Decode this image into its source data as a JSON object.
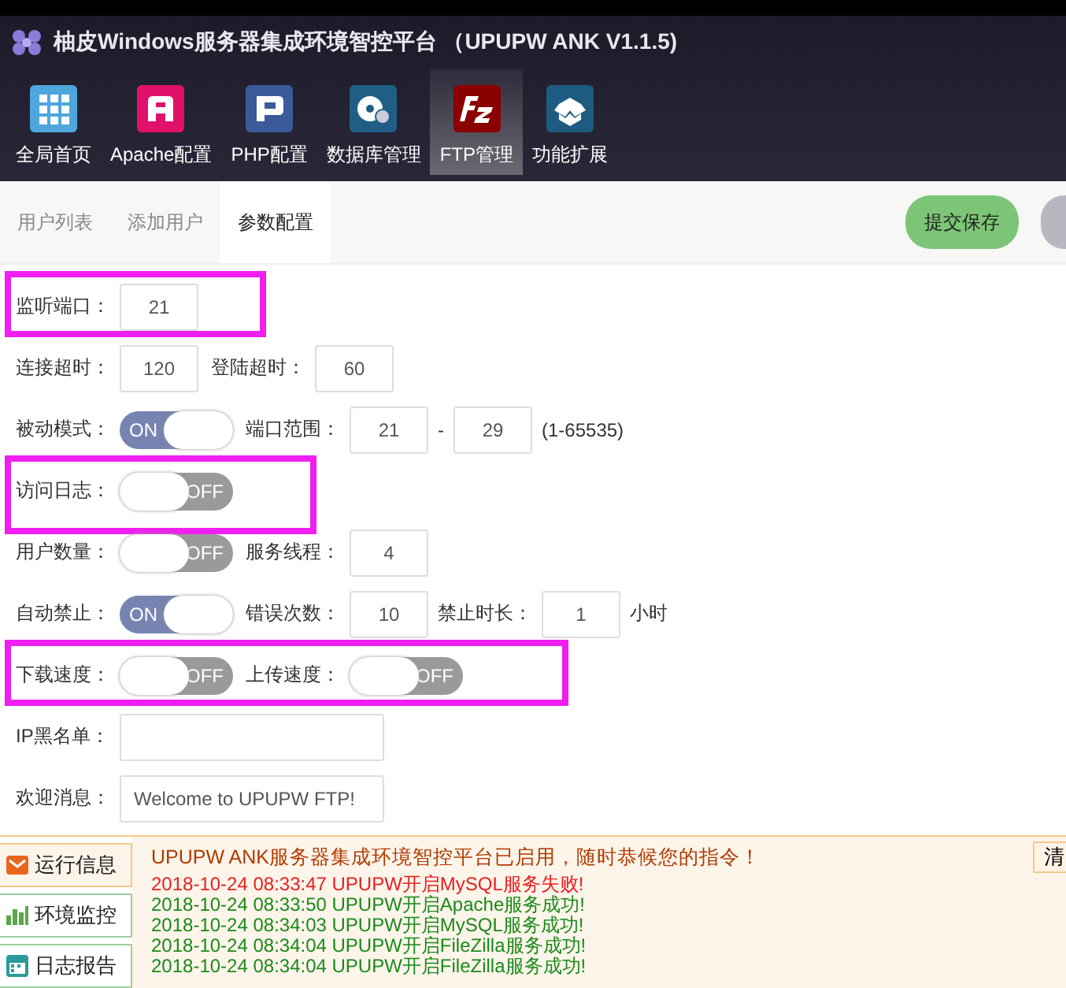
{
  "window": {
    "title": "柚皮Windows服务器集成环境智控平台 （UPUPW ANK V1.1.5)"
  },
  "toolbar": [
    {
      "label": "全局首页",
      "kind": "grid",
      "selected": false
    },
    {
      "label": "Apache配置",
      "kind": "apache",
      "selected": false
    },
    {
      "label": "PHP配置",
      "kind": "php",
      "selected": false
    },
    {
      "label": "数据库管理",
      "kind": "database",
      "selected": false
    },
    {
      "label": "FTP管理",
      "kind": "ftp",
      "selected": true
    },
    {
      "label": "功能扩展",
      "kind": "box",
      "selected": false
    }
  ],
  "sub_tabs": [
    {
      "label": "用户列表",
      "selected": false
    },
    {
      "label": "添加用户",
      "selected": false
    },
    {
      "label": "参数配置",
      "selected": true
    }
  ],
  "save_button": "提交保存",
  "form_rows": [
    {
      "highlighted": true,
      "items": [
        {
          "kind": "label",
          "text": "监听端口："
        },
        {
          "kind": "input",
          "value": "21"
        }
      ]
    },
    {
      "highlighted": false,
      "items": [
        {
          "kind": "label",
          "text": "连接超时："
        },
        {
          "kind": "input",
          "value": "120"
        },
        {
          "kind": "label",
          "text": "登陆超时："
        },
        {
          "kind": "input",
          "value": "60"
        }
      ]
    },
    {
      "highlighted": false,
      "items": [
        {
          "kind": "label",
          "text": "被动模式："
        },
        {
          "kind": "toggle",
          "on": true,
          "text": "ON"
        },
        {
          "kind": "label",
          "text": "端口范围："
        },
        {
          "kind": "input",
          "value": "21"
        },
        {
          "kind": "text",
          "text": "-"
        },
        {
          "kind": "input",
          "value": "29"
        },
        {
          "kind": "text",
          "text": "(1-65535)"
        }
      ]
    },
    {
      "highlighted": true,
      "items": [
        {
          "kind": "label",
          "text": "访问日志："
        },
        {
          "kind": "toggle",
          "on": false,
          "text": "OFF"
        }
      ]
    },
    {
      "highlighted": false,
      "items": [
        {
          "kind": "label",
          "text": "用户数量："
        },
        {
          "kind": "toggle",
          "on": false,
          "text": "OFF"
        },
        {
          "kind": "label",
          "text": "服务线程："
        },
        {
          "kind": "input",
          "value": "4"
        }
      ]
    },
    {
      "highlighted": false,
      "items": [
        {
          "kind": "label",
          "text": "自动禁止："
        },
        {
          "kind": "toggle",
          "on": true,
          "text": "ON"
        },
        {
          "kind": "label",
          "text": "错误次数："
        },
        {
          "kind": "input",
          "value": "10"
        },
        {
          "kind": "text",
          "text": "禁止时长："
        },
        {
          "kind": "input",
          "value": "1"
        },
        {
          "kind": "text",
          "text": "小时"
        }
      ]
    },
    {
      "highlighted": true,
      "items": [
        {
          "kind": "label",
          "text": "下载速度："
        },
        {
          "kind": "toggle",
          "on": false,
          "text": "OFF"
        },
        {
          "kind": "label",
          "text": "上传速度："
        },
        {
          "kind": "toggle",
          "on": false,
          "text": "OFF"
        }
      ]
    },
    {
      "highlighted": false,
      "items": [
        {
          "kind": "label",
          "text": "IP黑名单："
        },
        {
          "kind": "wide_input",
          "value": ""
        }
      ]
    },
    {
      "highlighted": false,
      "items": [
        {
          "kind": "label",
          "text": "欢迎消息："
        },
        {
          "kind": "wide_input",
          "value": "Welcome to UPUPW FTP!"
        }
      ]
    }
  ],
  "side_tabs": [
    {
      "label": "运行信息",
      "kind": "mail",
      "selected": true
    },
    {
      "label": "环境监控",
      "kind": "bars",
      "selected": false
    },
    {
      "label": "日志报告",
      "kind": "calendar",
      "selected": false
    }
  ],
  "log": {
    "message": "UPUPW ANK服务器集成环境智控平台已启用，随时恭候您的指令！",
    "clear_button": "清",
    "entries": [
      {
        "text": "2018-10-24 08:33:47 UPUPW开启MySQL服务失败!",
        "color": "#e82020"
      },
      {
        "text": "2018-10-24 08:33:50 UPUPW开启Apache服务成功!",
        "color": "#1a8a1a"
      },
      {
        "text": "2018-10-24 08:34:03 UPUPW开启MySQL服务成功!",
        "color": "#1a8a1a"
      },
      {
        "text": "2018-10-24 08:34:04 UPUPW开启FileZilla服务成功!",
        "color": "#1a8a1a"
      },
      {
        "text": "2018-10-24 08:34:04 UPUPW开启FileZilla服务成功!",
        "color": "#1a8a1a"
      }
    ]
  }
}
